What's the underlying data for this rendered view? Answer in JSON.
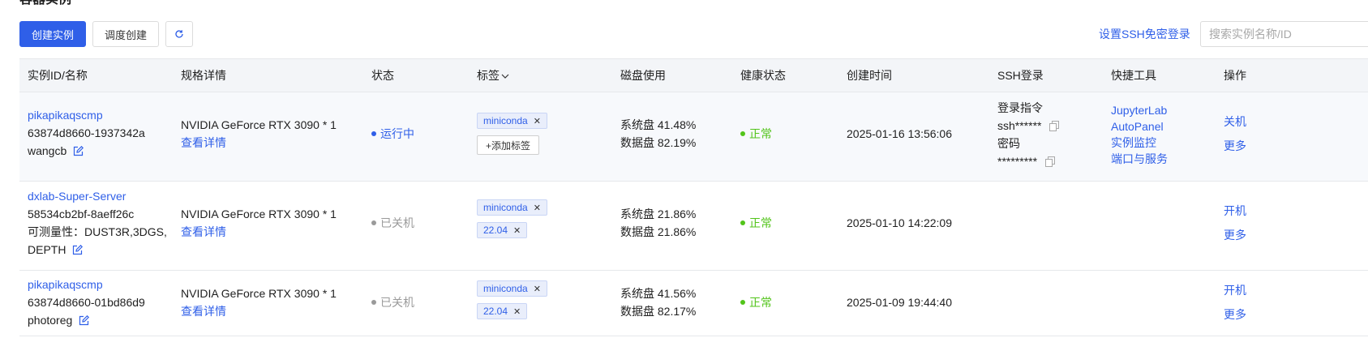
{
  "page_title": "容器实例",
  "toolbar": {
    "create_label": "创建实例",
    "schedule_label": "调度创建",
    "refresh_icon": "refresh-icon",
    "ssh_link": "设置SSH免密登录",
    "search_placeholder": "搜索实例名称/ID"
  },
  "colors": {
    "primary": "#2f5fe8",
    "healthy": "#52c41a",
    "running": "#2f5fe8",
    "stopped": "#9a9a9a",
    "header_bg": "#f3f5f8"
  },
  "columns": [
    "实例ID/名称",
    "规格详情",
    "状态",
    "标签",
    "磁盘使用",
    "健康状态",
    "创建时间",
    "SSH登录",
    "快捷工具",
    "操作"
  ],
  "rows": [
    {
      "name": "pikapikaqscmp",
      "id": "63874d8660-1937342a",
      "remark": "wangcb",
      "spec": "NVIDIA GeForce RTX 3090 * 1",
      "spec_link": "查看详情",
      "status": "运行中",
      "tags": [
        "miniconda"
      ],
      "add_tag": "+添加标签",
      "disk_sys": "系统盘 41.48%",
      "disk_data": "数据盘 82.19%",
      "health": "正常",
      "created": "2025-01-16 13:56:06",
      "ssh_cmd_label": "登录指令",
      "ssh_cmd": "ssh******",
      "ssh_pwd_label": "密码",
      "ssh_pwd": "*********",
      "tools": [
        "JupyterLab",
        "AutoPanel",
        "实例监控",
        "端口与服务"
      ],
      "action": "关机",
      "more": "更多"
    },
    {
      "name": "dxlab-Super-Server",
      "id": "58534cb2bf-8aeff26c",
      "remark_line1": "可测量性：DUST3R,3DGS,",
      "remark_line2": "DEPTH",
      "spec": "NVIDIA GeForce RTX 3090 * 1",
      "spec_link": "查看详情",
      "status": "已关机",
      "tags": [
        "miniconda",
        "22.04"
      ],
      "disk_sys": "系统盘 21.86%",
      "disk_data": "数据盘 21.86%",
      "health": "正常",
      "created": "2025-01-10 14:22:09",
      "action": "开机",
      "more": "更多"
    },
    {
      "name": "pikapikaqscmp",
      "id": "63874d8660-01bd86d9",
      "remark": "photoreg",
      "spec": "NVIDIA GeForce RTX 3090 * 1",
      "spec_link": "查看详情",
      "status": "已关机",
      "tags": [
        "miniconda",
        "22.04"
      ],
      "disk_sys": "系统盘 41.56%",
      "disk_data": "数据盘 82.17%",
      "health": "正常",
      "created": "2025-01-09 19:44:40",
      "action": "开机",
      "more": "更多"
    }
  ]
}
